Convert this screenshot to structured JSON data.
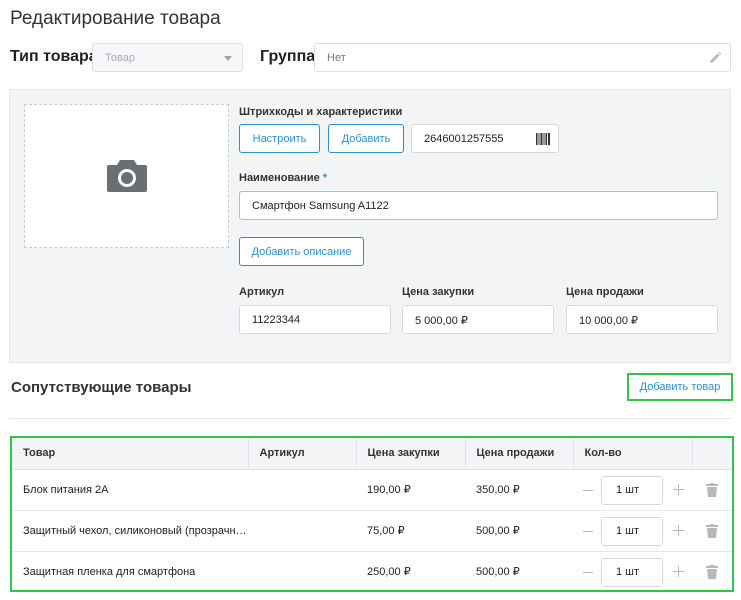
{
  "page": {
    "title": "Редактирование товара"
  },
  "type": {
    "label": "Тип товара",
    "value": "Товар"
  },
  "group": {
    "label": "Группа",
    "value": "Нет"
  },
  "barcodes": {
    "label": "Штрихкоды и характеристики",
    "configure_label": "Настроить",
    "add_label": "Добавить",
    "value": "2646001257555"
  },
  "name": {
    "label": "Наименование",
    "required_mark": "*",
    "value": "Смартфон Samsung A1122"
  },
  "description": {
    "add_label": "Добавить описание"
  },
  "sku": {
    "label": "Артикул",
    "value": "11223344"
  },
  "purchase_price": {
    "label": "Цена закупки",
    "value": "5 000,00 ₽"
  },
  "sale_price": {
    "label": "Цена продажи",
    "value": "10 000,00 ₽"
  },
  "related": {
    "title": "Сопутствующие товары",
    "add_label": "Добавить товар",
    "columns": [
      "Товар",
      "Артикул",
      "Цена закупки",
      "Цена продажи",
      "Кол-во",
      ""
    ],
    "rows": [
      {
        "name": "Блок питания 2А",
        "sku": "",
        "purchase": "190,00 ₽",
        "sale": "350,00 ₽",
        "qty": "1 шт"
      },
      {
        "name": "Защитный чехол, силиконовый (прозрачный)",
        "sku": "",
        "purchase": "75,00 ₽",
        "sale": "500,00 ₽",
        "qty": "1 шт"
      },
      {
        "name": "Защитная пленка для смартфона",
        "sku": "",
        "purchase": "250,00 ₽",
        "sale": "500,00 ₽",
        "qty": "1 шт"
      }
    ]
  },
  "icons": {
    "type_dropdown": "chevron-down-icon",
    "group_edit": "pencil-icon",
    "photo": "camera-icon",
    "barcode": "barcode-icon",
    "qty_decrease": "minus-icon",
    "qty_increase": "plus-icon",
    "delete": "trash-icon"
  },
  "colors": {
    "accent": "#2a8fd4",
    "highlight": "#2ec447",
    "panel_bg": "#f3f4f6"
  }
}
